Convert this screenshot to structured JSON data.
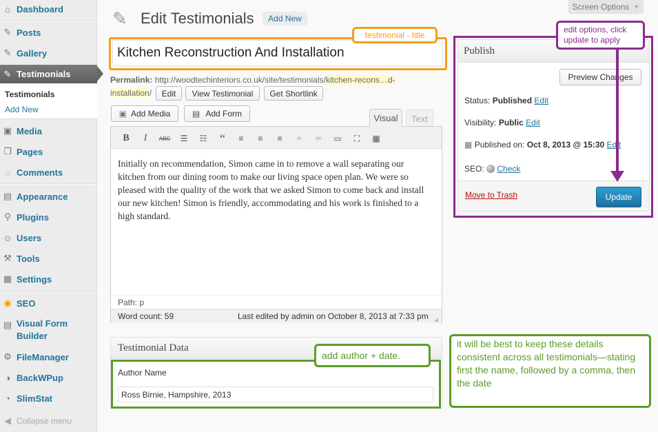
{
  "sidebar": {
    "items": [
      {
        "label": "Dashboard",
        "icon": "dashboard-icon"
      },
      {
        "label": "Posts",
        "icon": "pin-icon"
      },
      {
        "label": "Gallery",
        "icon": "gallery-icon"
      },
      {
        "label": "Testimonials",
        "icon": "pin-icon"
      },
      {
        "label": "Media",
        "icon": "media-icon"
      },
      {
        "label": "Pages",
        "icon": "pages-icon"
      },
      {
        "label": "Comments",
        "icon": "comments-icon"
      },
      {
        "label": "Appearance",
        "icon": "appearance-icon"
      },
      {
        "label": "Plugins",
        "icon": "plugins-icon"
      },
      {
        "label": "Users",
        "icon": "users-icon"
      },
      {
        "label": "Tools",
        "icon": "tools-icon"
      },
      {
        "label": "Settings",
        "icon": "settings-icon"
      },
      {
        "label": "SEO",
        "icon": "seo-icon"
      },
      {
        "label": "Visual Form Builder",
        "label_line1": "Visual Form",
        "label_line2": "Builder",
        "icon": "form-icon"
      },
      {
        "label": "FileManager",
        "icon": "filemanager-icon"
      },
      {
        "label": "BackWPup",
        "icon": "backwpup-icon"
      },
      {
        "label": "SlimStat",
        "icon": "slimstat-icon"
      }
    ],
    "submenu": {
      "current": "Testimonials",
      "add_new": "Add New"
    },
    "collapse": "Collapse menu"
  },
  "header": {
    "title": "Edit Testimonials",
    "add_new": "Add New",
    "screen_options": "Screen Options"
  },
  "editor": {
    "title_value": "Kitchen Reconstruction And Installation",
    "permalink_label": "Permalink:",
    "permalink_base": "http://woodtechinteriors.co.uk/site/testimonials/",
    "permalink_slug_a": "kitchen-recons…d-",
    "permalink_slug_b": "installation",
    "permalink_end": "/",
    "edit_btn": "Edit",
    "view_btn": "View Testimonial",
    "shortlink_btn": "Get Shortlink",
    "add_media": "Add Media",
    "add_form": "Add Form",
    "tab_visual": "Visual",
    "tab_text": "Text",
    "content": "Initially on recommendation, Simon came in to remove a wall separating our kitchen from our dining room to make our living space open plan. We were so pleased with the quality of the work that we asked Simon to come back and install our new kitchen! Simon is friendly, accommodating and his work is finished to a high standard.",
    "path": "Path: p",
    "word_count": "Word count: 59",
    "last_edited": "Last edited by admin on October 8, 2013 at 7:33 pm",
    "toolbar_glyphs": {
      "bold": "B",
      "italic": "I",
      "strike": "ABC",
      "quote": "“"
    }
  },
  "publish": {
    "title": "Publish",
    "preview": "Preview Changes",
    "status_label": "Status:",
    "status_value": "Published",
    "visibility_label": "Visibility:",
    "visibility_value": "Public",
    "published_label": "Published on:",
    "published_value": "Oct 8, 2013 @ 15:30",
    "seo_label": "SEO:",
    "seo_link": "Check",
    "edit": "Edit",
    "trash": "Move to Trash",
    "update": "Update"
  },
  "testimonial_data": {
    "title": "Testimonial Data",
    "author_label": "Author Name",
    "author_value": "Ross Birnie, Hampshire, 2013"
  },
  "annotations": {
    "title_note": "testimonial - title",
    "publish_note": "edit options, click update to apply",
    "author_note": "add author + date.",
    "consistency_note": "it will be best to keep these details consistent across all testimonials—stating first the name, followed by a comma, then the date"
  },
  "colors": {
    "orange": "#f59d1a",
    "purple": "#8b2c8f",
    "green": "#5c9c2a",
    "link": "#21759b",
    "update": "#2a8bc0"
  }
}
